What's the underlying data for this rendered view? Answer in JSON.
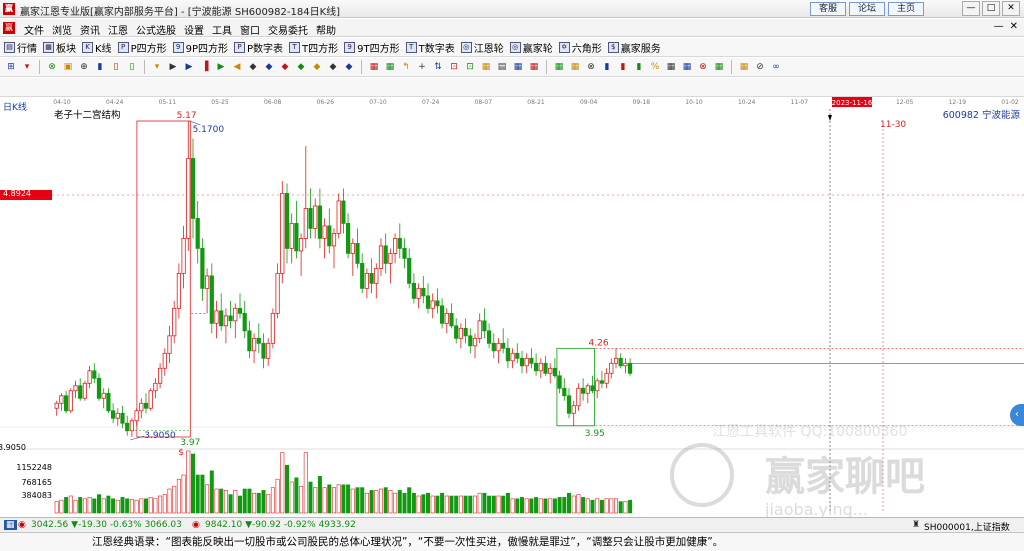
{
  "window": {
    "title": "赢家江恩专业版[赢家内部服务平台] - [宁波能源  SH600982-184日K线]",
    "logo": "赢",
    "links": [
      "客服",
      "论坛",
      "主页"
    ],
    "controls": [
      "—",
      "□",
      "✕"
    ]
  },
  "menubar": {
    "logo": "赢",
    "items": [
      "文件",
      "浏览",
      "资讯",
      "江恩",
      "公式选股",
      "设置",
      "工具",
      "窗口",
      "交易委托",
      "帮助"
    ],
    "right": [
      "—",
      "✕"
    ]
  },
  "toolbar1": {
    "items": [
      {
        "icon": "▤",
        "label": "行情"
      },
      {
        "icon": "▦",
        "label": "板块"
      },
      {
        "icon": "K",
        "label": "K线"
      },
      {
        "icon": "P",
        "label": "P四方形"
      },
      {
        "icon": "9",
        "label": "9P四方形"
      },
      {
        "icon": "P",
        "label": "P数字表"
      },
      {
        "icon": "T",
        "label": "T四方形"
      },
      {
        "icon": "9",
        "label": "9T四方形"
      },
      {
        "icon": "T",
        "label": "T数字表"
      },
      {
        "icon": "◎",
        "label": "江恩轮"
      },
      {
        "icon": "◎",
        "label": "赢家轮"
      },
      {
        "icon": "✡",
        "label": "六角形"
      },
      {
        "icon": "$",
        "label": "赢家服务"
      }
    ]
  },
  "toolbar2": {
    "icons": [
      "⊞",
      "▾",
      "⊗",
      "▣",
      "⊕",
      "▮",
      "▯",
      "▯",
      "▾",
      "▶",
      "▶",
      "▐",
      "▶",
      "◀",
      "◆",
      "◆",
      "◆",
      "◆",
      "◆",
      "◆",
      "◆",
      "▦",
      "▦",
      "↰",
      "+",
      "⇅",
      "⊡",
      "⊡",
      "▦",
      "▤",
      "▦",
      "▦",
      "▦",
      "▦",
      "⊗",
      "▮",
      "▮",
      "▮",
      "%",
      "▦",
      "▦",
      "⊗",
      "▦",
      "▦",
      "⊘",
      "∞"
    ]
  },
  "chart_data": {
    "type": "candlestick",
    "panel_label": "日K线",
    "pattern_label": "老子十二宫结构",
    "stock_label": "600982 宁波能源",
    "date_ticks": [
      "04-10",
      "04-24",
      "05-11",
      "05-25",
      "06-08",
      "06-26",
      "07-10",
      "07-24",
      "08-07",
      "08-21",
      "09-04",
      "09-18",
      "10-10",
      "10-24",
      "11-07",
      "2023-11-16",
      "12-05",
      "12-19",
      "01-02"
    ],
    "cursor_date": "2023-11-16",
    "future_mark": "11-30",
    "price_tag": "4.8924",
    "y_bottom_label": "3.9050",
    "annotations": {
      "high_box_top": "5.17",
      "high_value": "5.1700",
      "low_box_value": "3.9050",
      "low_box_bottom": "3.97",
      "dollar": "$",
      "box2_top": "4.26",
      "box2_bottom": "3.95"
    },
    "volume_labels": [
      "1152248",
      "768165",
      "384083"
    ],
    "candles": [
      [
        4.02,
        4.05,
        3.99,
        4.04
      ],
      [
        4.04,
        4.08,
        4.01,
        4.07
      ],
      [
        4.07,
        4.09,
        4.0,
        4.01
      ],
      [
        4.01,
        4.1,
        4.0,
        4.09
      ],
      [
        4.09,
        4.13,
        4.06,
        4.11
      ],
      [
        4.11,
        4.14,
        4.05,
        4.06
      ],
      [
        4.06,
        4.13,
        4.05,
        4.12
      ],
      [
        4.12,
        4.19,
        4.1,
        4.17
      ],
      [
        4.17,
        4.2,
        4.12,
        4.14
      ],
      [
        4.14,
        4.16,
        4.05,
        4.06
      ],
      [
        4.06,
        4.1,
        4.02,
        4.08
      ],
      [
        4.08,
        4.1,
        4.0,
        4.01
      ],
      [
        4.01,
        4.04,
        3.96,
        3.98
      ],
      [
        3.98,
        4.02,
        3.95,
        4.0
      ],
      [
        4.0,
        4.03,
        3.94,
        3.96
      ],
      [
        3.96,
        3.99,
        3.91,
        3.93
      ],
      [
        3.93,
        3.98,
        3.905,
        3.97
      ],
      [
        3.97,
        4.02,
        3.95,
        4.01
      ],
      [
        4.01,
        4.06,
        3.98,
        4.04
      ],
      [
        4.04,
        4.08,
        4.0,
        4.02
      ],
      [
        4.02,
        4.1,
        4.01,
        4.09
      ],
      [
        4.09,
        4.14,
        4.06,
        4.12
      ],
      [
        4.12,
        4.2,
        4.1,
        4.18
      ],
      [
        4.18,
        4.26,
        4.15,
        4.24
      ],
      [
        4.24,
        4.35,
        4.2,
        4.31
      ],
      [
        4.31,
        4.45,
        4.28,
        4.42
      ],
      [
        4.42,
        4.6,
        4.38,
        4.56
      ],
      [
        4.56,
        4.75,
        4.5,
        4.7
      ],
      [
        4.7,
        5.17,
        4.65,
        5.02
      ],
      [
        5.02,
        5.1,
        4.7,
        4.78
      ],
      [
        4.78,
        4.85,
        4.6,
        4.66
      ],
      [
        4.66,
        4.7,
        4.45,
        4.5
      ],
      [
        4.5,
        4.58,
        4.4,
        4.55
      ],
      [
        4.55,
        4.6,
        4.32,
        4.36
      ],
      [
        4.36,
        4.45,
        4.3,
        4.41
      ],
      [
        4.41,
        4.48,
        4.33,
        4.35
      ],
      [
        4.35,
        4.42,
        4.28,
        4.39
      ],
      [
        4.39,
        4.45,
        4.34,
        4.37
      ],
      [
        4.37,
        4.44,
        4.3,
        4.42
      ],
      [
        4.42,
        4.48,
        4.38,
        4.4
      ],
      [
        4.4,
        4.45,
        4.3,
        4.33
      ],
      [
        4.33,
        4.37,
        4.22,
        4.25
      ],
      [
        4.25,
        4.32,
        4.2,
        4.3
      ],
      [
        4.3,
        4.36,
        4.24,
        4.28
      ],
      [
        4.28,
        4.32,
        4.18,
        4.22
      ],
      [
        4.22,
        4.3,
        4.19,
        4.28
      ],
      [
        4.28,
        4.42,
        4.26,
        4.4
      ],
      [
        4.4,
        4.6,
        4.38,
        4.56
      ],
      [
        4.56,
        4.93,
        4.52,
        4.88
      ],
      [
        4.88,
        4.92,
        4.6,
        4.66
      ],
      [
        4.66,
        4.8,
        4.6,
        4.76
      ],
      [
        4.76,
        4.85,
        4.62,
        4.65
      ],
      [
        4.65,
        4.72,
        4.55,
        4.7
      ],
      [
        4.7,
        5.07,
        4.66,
        4.82
      ],
      [
        4.82,
        4.9,
        4.7,
        4.74
      ],
      [
        4.74,
        4.86,
        4.7,
        4.83
      ],
      [
        4.83,
        4.9,
        4.66,
        4.7
      ],
      [
        4.7,
        4.78,
        4.62,
        4.75
      ],
      [
        4.75,
        4.82,
        4.64,
        4.67
      ],
      [
        4.67,
        4.74,
        4.58,
        4.72
      ],
      [
        4.72,
        4.88,
        4.7,
        4.85
      ],
      [
        4.85,
        4.9,
        4.72,
        4.76
      ],
      [
        4.76,
        4.8,
        4.62,
        4.64
      ],
      [
        4.64,
        4.7,
        4.55,
        4.68
      ],
      [
        4.68,
        4.74,
        4.58,
        4.6
      ],
      [
        4.6,
        4.64,
        4.48,
        4.5
      ],
      [
        4.5,
        4.58,
        4.46,
        4.56
      ],
      [
        4.56,
        4.62,
        4.48,
        4.52
      ],
      [
        4.52,
        4.6,
        4.46,
        4.58
      ],
      [
        4.58,
        4.7,
        4.55,
        4.67
      ],
      [
        4.67,
        4.72,
        4.56,
        4.6
      ],
      [
        4.6,
        4.66,
        4.52,
        4.64
      ],
      [
        4.64,
        4.72,
        4.6,
        4.7
      ],
      [
        4.7,
        4.76,
        4.62,
        4.66
      ],
      [
        4.66,
        4.7,
        4.58,
        4.62
      ],
      [
        4.62,
        4.66,
        4.5,
        4.52
      ],
      [
        4.52,
        4.56,
        4.44,
        4.46
      ],
      [
        4.46,
        4.52,
        4.42,
        4.5
      ],
      [
        4.5,
        4.55,
        4.44,
        4.47
      ],
      [
        4.47,
        4.52,
        4.4,
        4.42
      ],
      [
        4.42,
        4.48,
        4.38,
        4.45
      ],
      [
        4.45,
        4.5,
        4.4,
        4.43
      ],
      [
        4.43,
        4.46,
        4.34,
        4.36
      ],
      [
        4.36,
        4.42,
        4.32,
        4.4
      ],
      [
        4.4,
        4.44,
        4.34,
        4.35
      ],
      [
        4.35,
        4.38,
        4.28,
        4.3
      ],
      [
        4.3,
        4.36,
        4.26,
        4.34
      ],
      [
        4.34,
        4.38,
        4.28,
        4.31
      ],
      [
        4.31,
        4.34,
        4.24,
        4.27
      ],
      [
        4.27,
        4.32,
        4.22,
        4.3
      ],
      [
        4.3,
        4.4,
        4.28,
        4.37
      ],
      [
        4.37,
        4.42,
        4.3,
        4.33
      ],
      [
        4.33,
        4.36,
        4.26,
        4.28
      ],
      [
        4.28,
        4.32,
        4.22,
        4.25
      ],
      [
        4.25,
        4.3,
        4.2,
        4.28
      ],
      [
        4.28,
        4.34,
        4.24,
        4.26
      ],
      [
        4.26,
        4.3,
        4.18,
        4.21
      ],
      [
        4.21,
        4.26,
        4.18,
        4.24
      ],
      [
        4.24,
        4.28,
        4.2,
        4.22
      ],
      [
        4.22,
        4.25,
        4.16,
        4.19
      ],
      [
        4.19,
        4.24,
        4.16,
        4.22
      ],
      [
        4.22,
        4.26,
        4.18,
        4.2
      ],
      [
        4.2,
        4.24,
        4.15,
        4.17
      ],
      [
        4.17,
        4.22,
        4.14,
        4.2
      ],
      [
        4.2,
        4.23,
        4.15,
        4.16
      ],
      [
        4.16,
        4.2,
        4.12,
        4.18
      ],
      [
        4.18,
        4.22,
        4.14,
        4.15
      ],
      [
        4.15,
        4.17,
        4.08,
        4.1
      ],
      [
        4.1,
        4.14,
        4.05,
        4.07
      ],
      [
        4.07,
        4.1,
        3.98,
        4.0
      ],
      [
        4.0,
        4.05,
        3.95,
        4.03
      ],
      [
        4.03,
        4.12,
        4.01,
        4.1
      ],
      [
        4.1,
        4.14,
        4.05,
        4.08
      ],
      [
        4.08,
        4.12,
        4.04,
        4.11
      ],
      [
        4.11,
        4.15,
        4.08,
        4.09
      ],
      [
        4.09,
        4.14,
        4.06,
        4.13
      ],
      [
        4.13,
        4.17,
        4.1,
        4.12
      ],
      [
        4.12,
        4.18,
        4.1,
        4.16
      ],
      [
        4.16,
        4.22,
        4.14,
        4.2
      ],
      [
        4.2,
        4.26,
        4.18,
        4.22
      ],
      [
        4.22,
        4.24,
        4.18,
        4.19
      ],
      [
        4.19,
        4.22,
        4.16,
        4.2
      ],
      [
        4.2,
        4.22,
        4.15,
        4.16
      ]
    ]
  },
  "statusbar": {
    "index1": "3042.56 ▼-19.30 -0.63% 3066.03",
    "index2": "9842.10 ▼-90.92 -0.92% 4933.92",
    "symbol": "SH000001,上证指数"
  },
  "quote": "江恩经典语录：“图表能反映出一切股市或公司股民的总体心理状况”，“不要一次性买进，傲慢就是罪过”，“调整只会让股市更加健康”。",
  "watermark": {
    "line1": "江恩工具软件  QQ:100800360",
    "line2": "赢家聊吧",
    "line3": "jiaoba.ying..."
  },
  "colors": {
    "up": "#e02020",
    "down": "#119911",
    "panel_grid": "#cccccc",
    "accent_red": "#e60012"
  }
}
